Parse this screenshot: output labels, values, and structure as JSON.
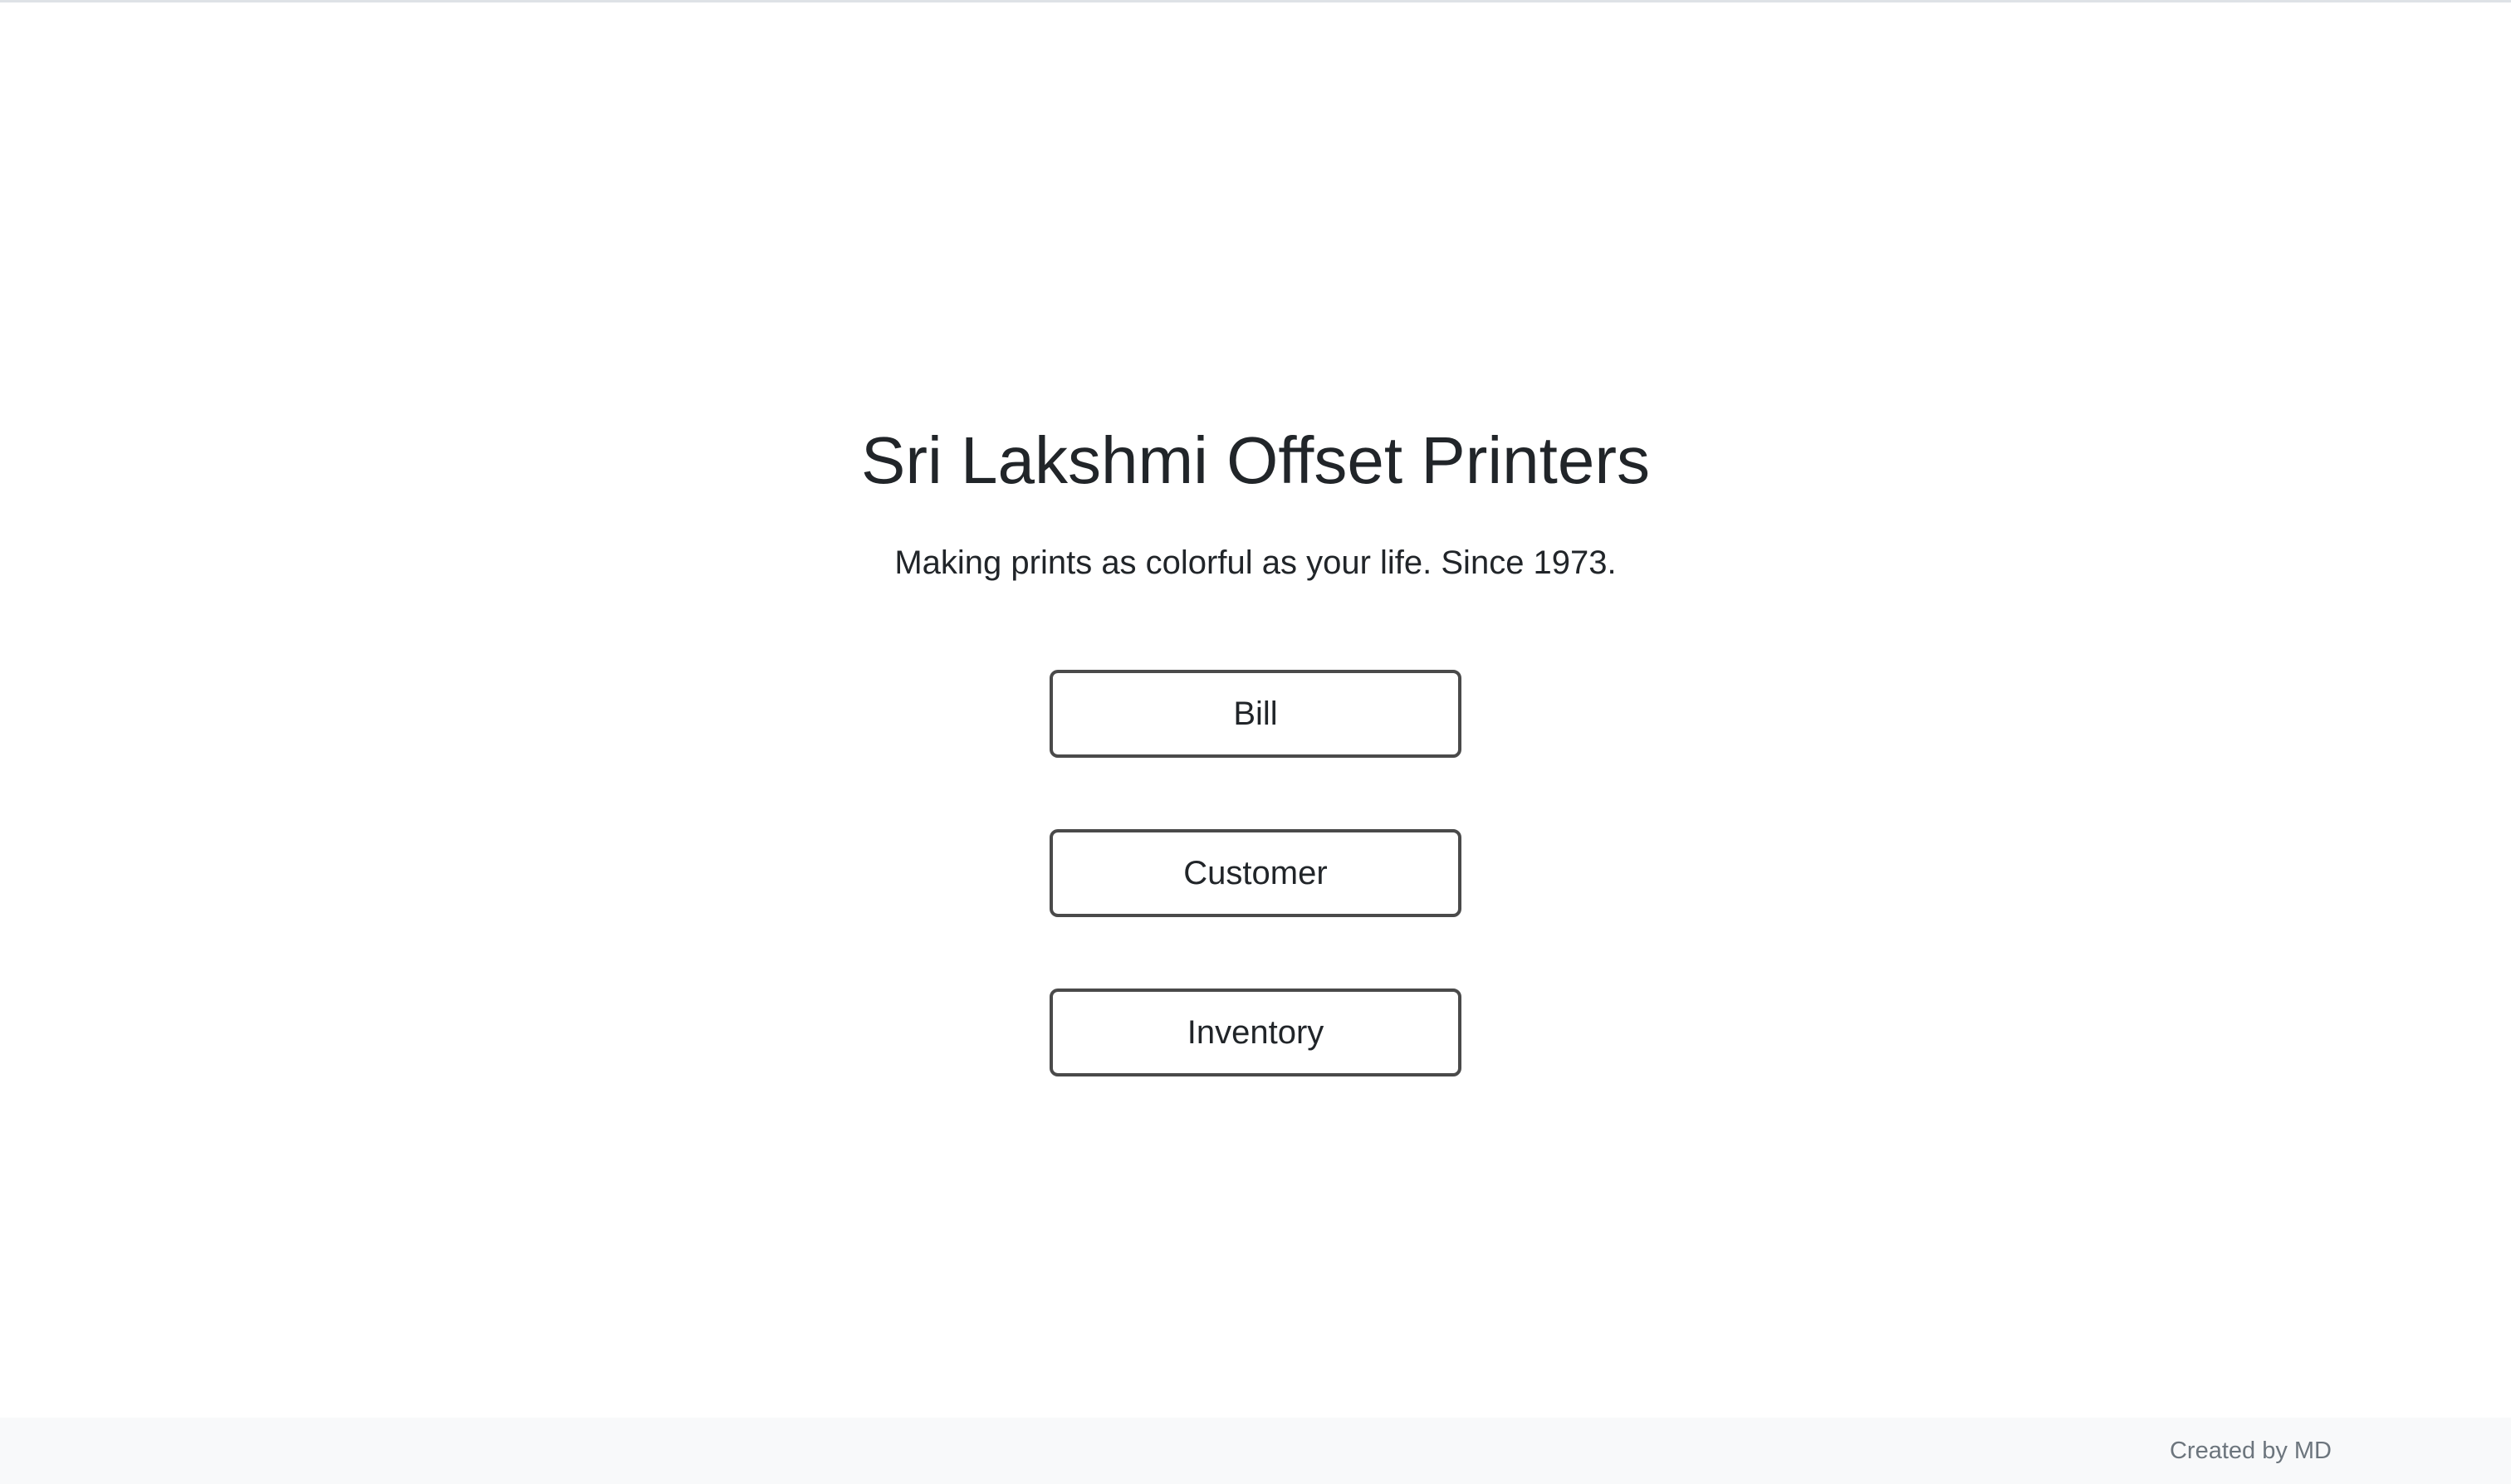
{
  "header": {
    "title": "Sri Lakshmi Offset Printers",
    "tagline": "Making prints as colorful as your life. Since 1973."
  },
  "menu": {
    "bill_label": "Bill",
    "customer_label": "Customer",
    "inventory_label": "Inventory"
  },
  "footer": {
    "credit": "Created by MD"
  },
  "colors": {
    "text": "#212529",
    "button_border": "#4a4a4a",
    "footer_bg": "#f8f9fa",
    "footer_text": "#6c757d"
  }
}
